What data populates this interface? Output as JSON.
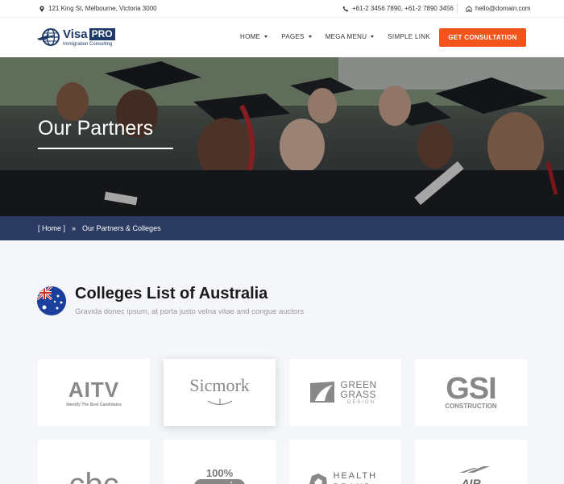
{
  "topbar": {
    "address": "121 King St, Melbourne, Victoria 3000",
    "phones": "+61-2 3456 7890,  +61-2 7890 3456",
    "email": "hello@domain.com"
  },
  "header": {
    "logo_main": "Visa",
    "logo_badge": "PRO",
    "logo_sub": "Immigration Consulting",
    "nav": [
      {
        "label": "HOME"
      },
      {
        "label": "PAGES"
      },
      {
        "label": "MEGA MENU"
      },
      {
        "label": "SIMPLE LINK"
      }
    ],
    "cta": "GET CONSULTATION"
  },
  "hero": {
    "title": "Our Partners"
  },
  "breadcrumb": {
    "home": "[ Home ]",
    "separator": "»",
    "current": "Our Partners & Colleges"
  },
  "section": {
    "title": "Colleges List of Australia",
    "subtitle": "Gravida donec ipsum, at porta justo velna vitae and congue auctors"
  },
  "partners": [
    {
      "name": "AITV",
      "tagline": "Identify The Best Candidates"
    },
    {
      "name": "Sicmork"
    },
    {
      "name": "GREEN GRASS",
      "tagline": "DESIGN"
    },
    {
      "name": "GSI",
      "tagline": "CONSTRUCTION"
    },
    {
      "name": "cbc"
    },
    {
      "name": "100%",
      "tagline": "organic"
    },
    {
      "name": "HEALTH BRAND"
    },
    {
      "name": "AIR EXPRESS"
    }
  ],
  "colors": {
    "accent": "#f2541b",
    "navy": "#2a3a61",
    "brand": "#1e3a68"
  }
}
